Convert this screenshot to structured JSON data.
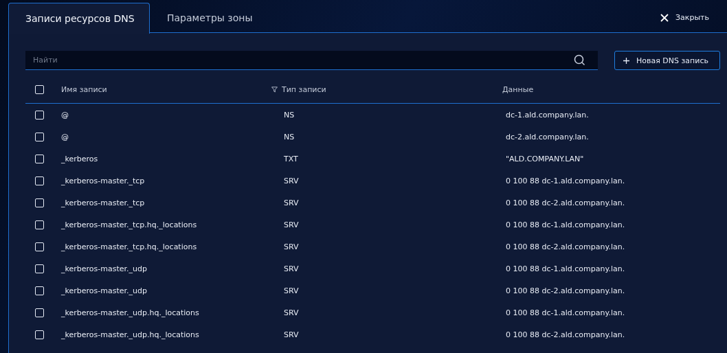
{
  "tabs": [
    {
      "label": "Записи ресурсов DNS",
      "selected": true
    },
    {
      "label": "Параметры зоны",
      "selected": false
    }
  ],
  "close": {
    "label": "Закрыть"
  },
  "search": {
    "placeholder": "Найти"
  },
  "new_button": {
    "label": "Новая DNS запись"
  },
  "table": {
    "select_all": {
      "checked": false
    },
    "columns": [
      {
        "label": "Имя записи",
        "filter": false
      },
      {
        "label": "Тип записи",
        "filter": true
      },
      {
        "label": "Данные",
        "filter": false
      }
    ],
    "rows": [
      {
        "checked": false,
        "name": "@",
        "type": "NS",
        "data": "dc-1.ald.company.lan."
      },
      {
        "checked": false,
        "name": "@",
        "type": "NS",
        "data": "dc-2.ald.company.lan."
      },
      {
        "checked": false,
        "name": "_kerberos",
        "type": "TXT",
        "data": "\"ALD.COMPANY.LAN\""
      },
      {
        "checked": false,
        "name": "_kerberos-master._tcp",
        "type": "SRV",
        "data": "0 100 88 dc-1.ald.company.lan."
      },
      {
        "checked": false,
        "name": "_kerberos-master._tcp",
        "type": "SRV",
        "data": "0 100 88 dc-2.ald.company.lan."
      },
      {
        "checked": false,
        "name": "_kerberos-master._tcp.hq._locations",
        "type": "SRV",
        "data": "0 100 88 dc-1.ald.company.lan."
      },
      {
        "checked": false,
        "name": "_kerberos-master._tcp.hq._locations",
        "type": "SRV",
        "data": "0 100 88 dc-2.ald.company.lan."
      },
      {
        "checked": false,
        "name": "_kerberos-master._udp",
        "type": "SRV",
        "data": "0 100 88 dc-1.ald.company.lan."
      },
      {
        "checked": false,
        "name": "_kerberos-master._udp",
        "type": "SRV",
        "data": "0 100 88 dc-2.ald.company.lan."
      },
      {
        "checked": false,
        "name": "_kerberos-master._udp.hq._locations",
        "type": "SRV",
        "data": "0 100 88 dc-1.ald.company.lan."
      },
      {
        "checked": false,
        "name": "_kerberos-master._udp.hq._locations",
        "type": "SRV",
        "data": "0 100 88 dc-2.ald.company.lan."
      }
    ]
  }
}
